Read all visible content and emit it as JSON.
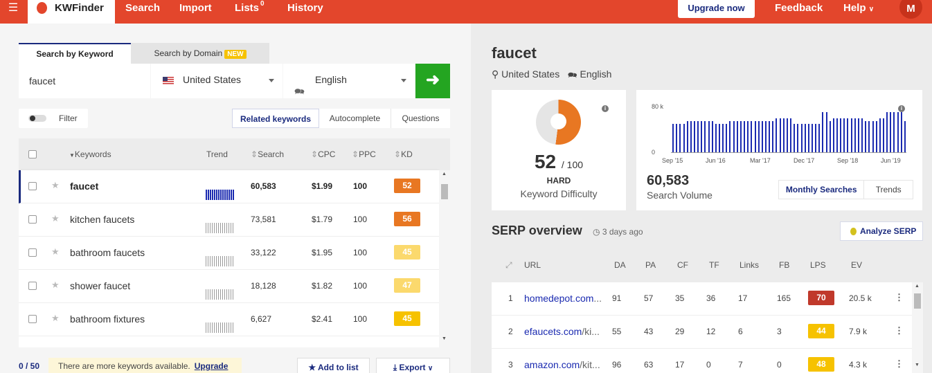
{
  "topbar": {
    "menu_icon": "hamburger-icon",
    "app_name": "KWFinder",
    "nav": [
      {
        "label": "Search"
      },
      {
        "label": "Import"
      },
      {
        "label": "Lists",
        "badge": "0"
      },
      {
        "label": "History"
      }
    ],
    "upgrade_label": "Upgrade now",
    "feedback_label": "Feedback",
    "help_label": "Help",
    "avatar_initial": "M",
    "accent_color": "#e3462c"
  },
  "search": {
    "tab_keyword": "Search by Keyword",
    "tab_domain": "Search by Domain",
    "new_badge": "NEW",
    "keyword_value": "faucet",
    "country": "United States",
    "language": "English"
  },
  "filter_label": "Filter",
  "keyword_tabs": [
    "Related keywords",
    "Autocomplete",
    "Questions"
  ],
  "table": {
    "headers": {
      "keywords": "Keywords",
      "trend": "Trend",
      "search": "Search",
      "cpc": "CPC",
      "ppc": "PPC",
      "kd": "KD"
    },
    "rows": [
      {
        "keyword": "faucet",
        "search": "60,583",
        "cpc": "$1.99",
        "ppc": "100",
        "kd": "52",
        "kd_color": "#e87722"
      },
      {
        "keyword": "kitchen faucets",
        "search": "73,581",
        "cpc": "$1.79",
        "ppc": "100",
        "kd": "56",
        "kd_color": "#e87722"
      },
      {
        "keyword": "bathroom faucets",
        "search": "33,122",
        "cpc": "$1.95",
        "ppc": "100",
        "kd": "45",
        "kd_color": "#fbd96d"
      },
      {
        "keyword": "shower faucet",
        "search": "18,128",
        "cpc": "$1.82",
        "ppc": "100",
        "kd": "47",
        "kd_color": "#fbd96d"
      },
      {
        "keyword": "bathroom fixtures",
        "search": "6,627",
        "cpc": "$2.41",
        "ppc": "100",
        "kd": "45",
        "kd_color": "#f6c200"
      }
    ]
  },
  "footer": {
    "count": "0 / 50",
    "more_text": "There are more keywords available.",
    "upgrade_link": "Upgrade",
    "add_to_list": "Add to list",
    "export": "Export"
  },
  "overview": {
    "keyword": "faucet",
    "country": "United States",
    "language": "English",
    "kd_value": "52",
    "kd_max": "/ 100",
    "kd_level": "HARD",
    "kd_label": "Keyword Difficulty",
    "sv_value": "60,583",
    "sv_label": "Search Volume",
    "sv_tabs": [
      "Monthly Searches",
      "Trends"
    ]
  },
  "chart_data": {
    "type": "bar",
    "title": "",
    "y_ticks": [
      "80 k",
      "0"
    ],
    "x_ticks": [
      "Sep '15",
      "Jun '16",
      "Mar '17",
      "Dec '17",
      "Sep '18",
      "Jun '19"
    ],
    "values": [
      60,
      60,
      60,
      60,
      66,
      66,
      66,
      66,
      66,
      66,
      66,
      66,
      60,
      60,
      60,
      60,
      66,
      66,
      66,
      66,
      66,
      66,
      66,
      66,
      66,
      66,
      66,
      66,
      66,
      72,
      72,
      72,
      72,
      72,
      60,
      60,
      60,
      60,
      60,
      60,
      60,
      60,
      85,
      85,
      66,
      72,
      72,
      72,
      72,
      72,
      72,
      72,
      72,
      72,
      66,
      66,
      66,
      66,
      72,
      72,
      85,
      85,
      85,
      85,
      85,
      66
    ],
    "ylim": [
      0,
      80000
    ],
    "bar_color": "#1a2ab0"
  },
  "serp": {
    "title": "SERP overview",
    "time": "3 days ago",
    "analyze_label": "Analyze SERP",
    "headers": {
      "url": "URL",
      "da": "DA",
      "pa": "PA",
      "cf": "CF",
      "tf": "TF",
      "links": "Links",
      "fb": "FB",
      "lps": "LPS",
      "ev": "EV"
    },
    "rows": [
      {
        "rank": "1",
        "domain": "homedepot.com",
        "path": "...",
        "da": "91",
        "pa": "57",
        "cf": "35",
        "tf": "36",
        "links": "17",
        "fb": "165",
        "lps": "70",
        "lps_color": "#c0392b",
        "ev": "20.5 k"
      },
      {
        "rank": "2",
        "domain": "efaucets.com",
        "path": "/ki...",
        "da": "55",
        "pa": "43",
        "cf": "29",
        "tf": "12",
        "links": "6",
        "fb": "3",
        "lps": "44",
        "lps_color": "#f6c200",
        "ev": "7.9 k"
      },
      {
        "rank": "3",
        "domain": "amazon.com",
        "path": "/kit...",
        "da": "96",
        "pa": "63",
        "cf": "17",
        "tf": "0",
        "links": "7",
        "fb": "0",
        "lps": "48",
        "lps_color": "#f6c200",
        "ev": "4.3 k"
      }
    ]
  }
}
